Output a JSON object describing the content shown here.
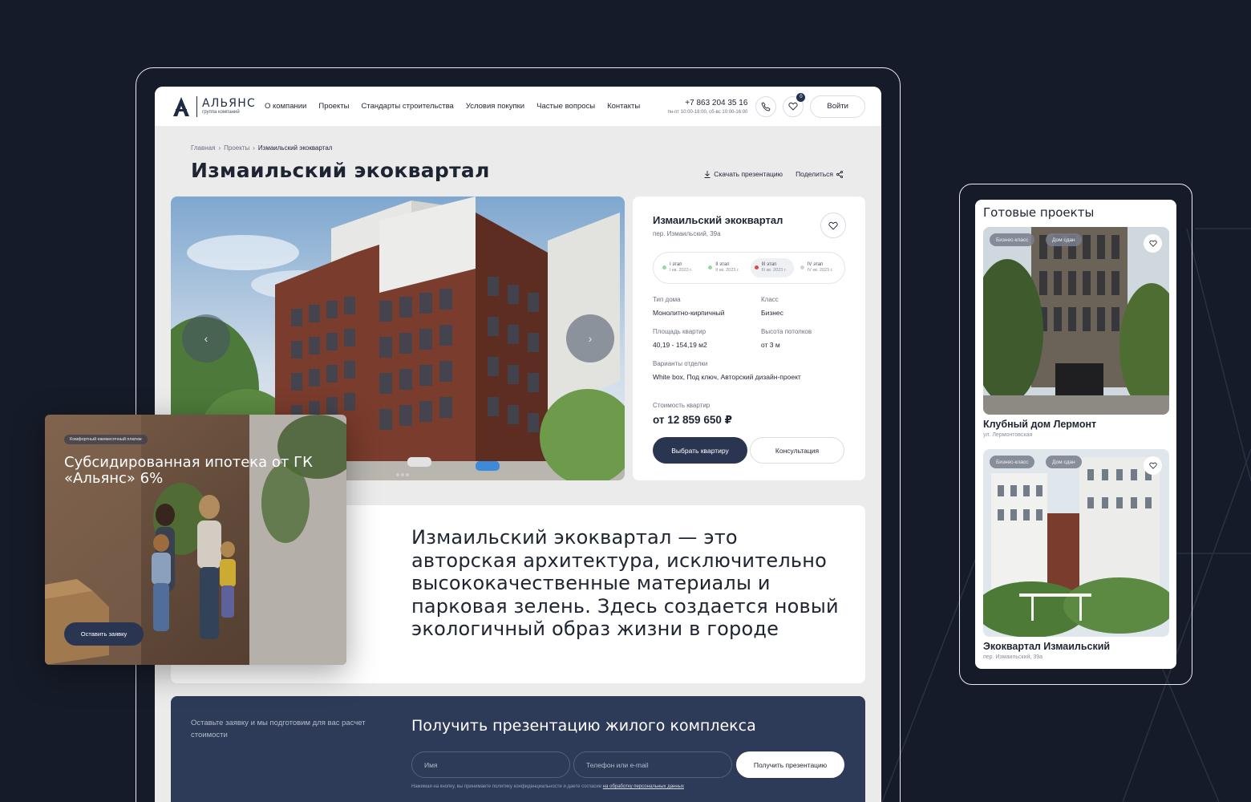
{
  "header": {
    "logo_name": "АЛЬЯНС",
    "logo_sub": "группа компаний",
    "nav": [
      "О компании",
      "Проекты",
      "Стандарты строительства",
      "Условия покупки",
      "Частые вопросы",
      "Контакты"
    ],
    "phone": "+7 863 204 35 16",
    "hours": "пн-пт 10:00-18:00, сб-вс 10:00-16:00",
    "favorites_count": "0",
    "login": "Войти"
  },
  "breadcrumbs": [
    "Главная",
    "Проекты",
    "Измаильский экоквартал"
  ],
  "page_title": "Измаильский экоквартал",
  "actions": {
    "download": "Скачать презентацию",
    "share": "Поделиться"
  },
  "hero": {
    "prev_arrow": "‹",
    "next_arrow": "›"
  },
  "info": {
    "title": "Измаильский экоквартал",
    "address": "пер. Измаильский, 39а",
    "stages": [
      {
        "name": "I этап",
        "date": "I кв. 2023 г."
      },
      {
        "name": "II этап",
        "date": "II кв. 2023 г."
      },
      {
        "name": "III этап",
        "date": "III кв. 2023 г."
      },
      {
        "name": "IV этап",
        "date": "IV кв. 2023 г."
      }
    ],
    "house_type_label": "Тип дома",
    "house_type": "Монолитно-кирпичный",
    "class_label": "Класс",
    "class": "Бизнес",
    "area_label": "Площадь квартир",
    "area": "40,19 - 154,19 м2",
    "ceiling_label": "Высота потолков",
    "ceiling": "от 3 м",
    "finish_label": "Варианты отделки",
    "finish": "White box, Под ключ, Авторский дизайн-проект",
    "price_label": "Стоимость квартир",
    "price": "от 12 859 650 ₽",
    "choose_btn": "Выбрать квартиру",
    "consult_btn": "Консультация"
  },
  "quote": "Измаильский экоквартал — это авторская архитектура, исключительно высококачественные материалы и парковая зелень. Здесь создается новый экологичный образ жизни в городе",
  "form": {
    "note": "Оставьте заявку и мы подготовим для вас расчет стоимости",
    "title": "Получить презентацию жилого комплекса",
    "name_placeholder": "Имя",
    "contact_placeholder": "Телефон или e-mail",
    "submit": "Получить презентацию",
    "legal_prefix": "Нажимая на кнопку, вы принимаете политику конфиденциальности и даете согласие",
    "legal_link": "на обработку персональных данных"
  },
  "promo": {
    "badge": "Комфортный ежемесячный платеж",
    "title": "Субсидированная ипотека от ГК «Альянс» 6%",
    "button": "Оставить заявку"
  },
  "mobile": {
    "title": "Готовые проекты",
    "projects": [
      {
        "tags": [
          "Бизнес-класс",
          "Дом сдан"
        ],
        "name": "Клубный дом Лермонт",
        "address": "ул. Лермонтовская"
      },
      {
        "tags": [
          "Бизнес-класс",
          "Дом сдан"
        ],
        "name": "Экоквартал Измаильский",
        "address": "пер. Измаильский, 39а"
      }
    ]
  },
  "colors": {
    "background": "#151b28",
    "accent": "#2a3552",
    "form_bg": "#2d3a58",
    "stage_done": "#9fd39f",
    "stage_current": "#e64545"
  }
}
